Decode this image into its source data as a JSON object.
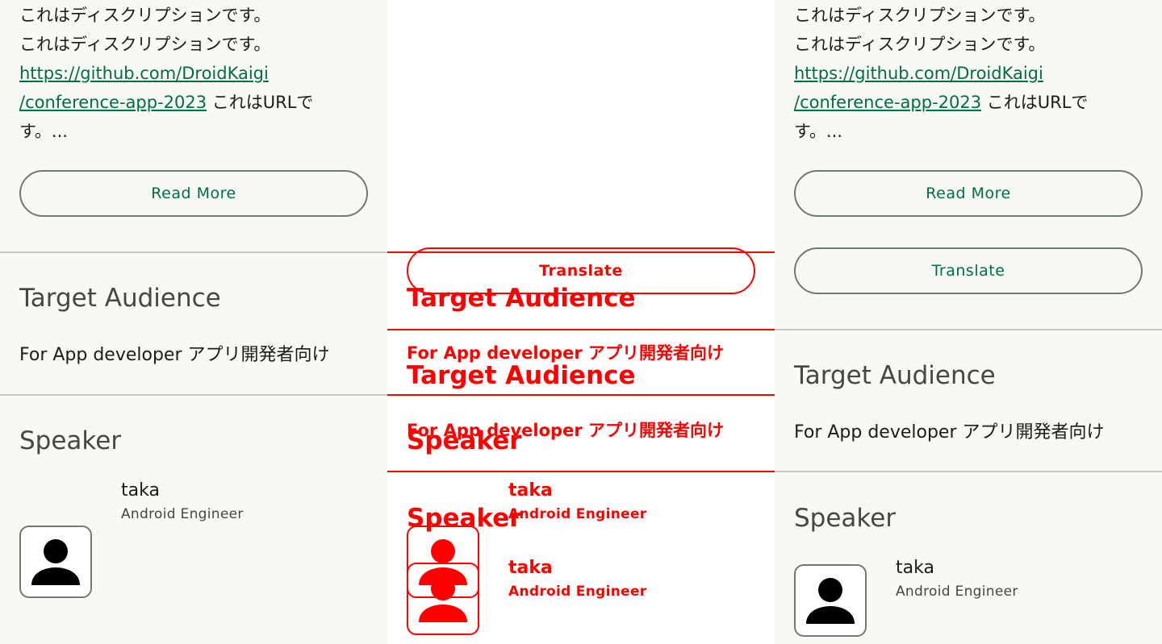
{
  "session": {
    "description_lines": [
      "これはディスクリプションです。",
      "これはディスクリプションです。"
    ],
    "url_part1": "https://github.com/DroidKaigi",
    "url_part2": "/conference-app-2023",
    "url_suffix": " これはURLで",
    "last_line": "す。..."
  },
  "buttons": {
    "read_more": "Read More",
    "translate": "Translate"
  },
  "target_audience": {
    "title": "Target Audience",
    "body": "For App developer アプリ開発者向け"
  },
  "speaker": {
    "title": "Speaker",
    "name": "taka",
    "role": "Android Engineer",
    "avatar_icon": "person-icon"
  },
  "colors": {
    "accent": "#006c48",
    "diff": "#ff0000",
    "background": "#f7f9f5",
    "outline": "#737872"
  }
}
